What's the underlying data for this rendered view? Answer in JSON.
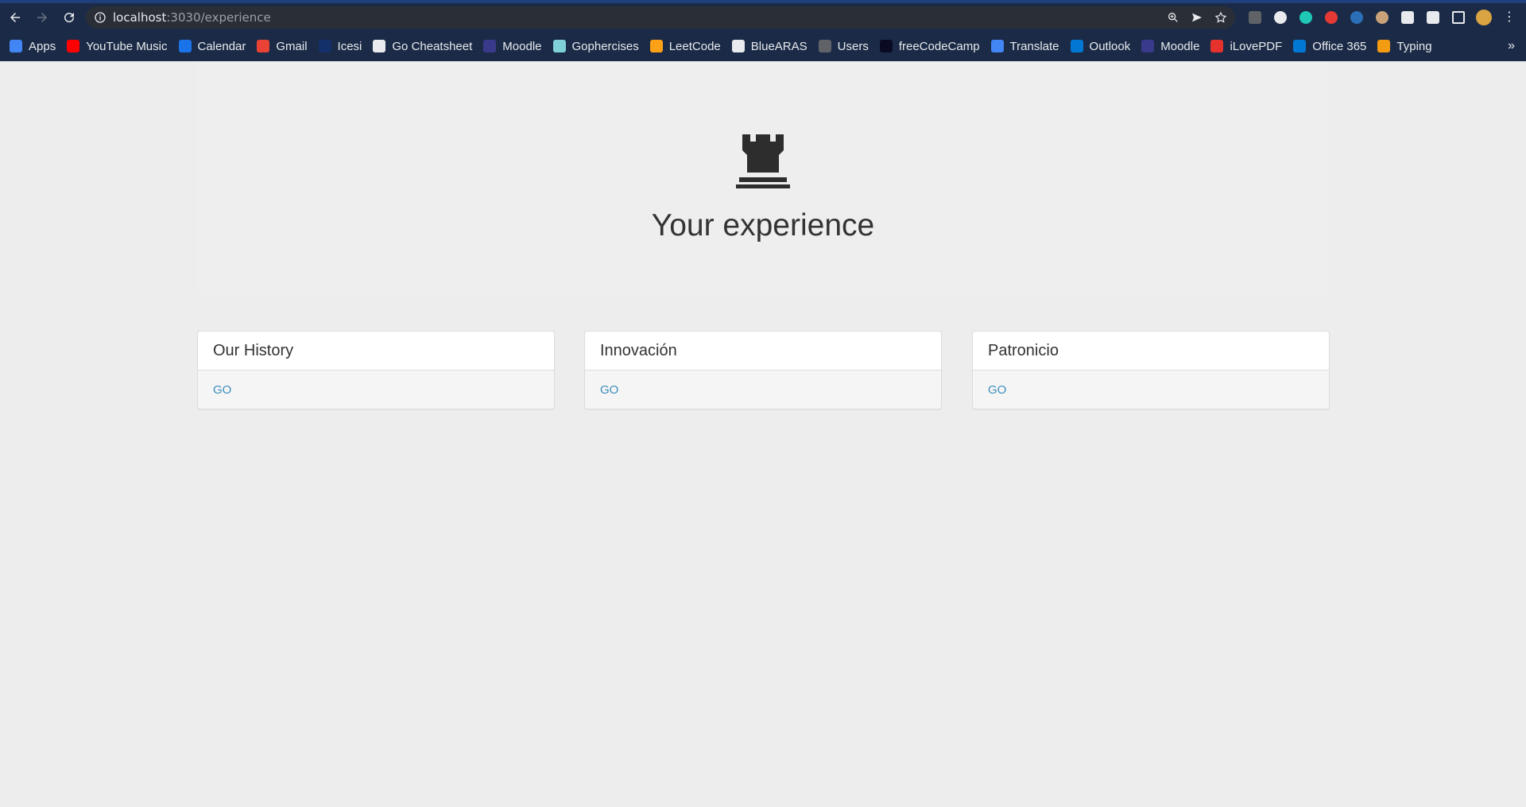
{
  "browser": {
    "url_host": "localhost",
    "url_path": ":3030/experience",
    "bookmarks": [
      {
        "label": "Apps",
        "icon": "apps-grid-icon",
        "color": "#4285f4"
      },
      {
        "label": "YouTube Music",
        "icon": "youtube-music-icon",
        "color": "#ff0000"
      },
      {
        "label": "Calendar",
        "icon": "calendar-icon",
        "color": "#1a73e8"
      },
      {
        "label": "Gmail",
        "icon": "gmail-icon",
        "color": "#ea4335"
      },
      {
        "label": "Icesi",
        "icon": "icesi-icon",
        "color": "#14306b"
      },
      {
        "label": "Go Cheatsheet",
        "icon": "github-icon",
        "color": "#e8eaed"
      },
      {
        "label": "Moodle",
        "icon": "moodle-icon",
        "color": "#3a3a8c"
      },
      {
        "label": "Gophercises",
        "icon": "gophercises-icon",
        "color": "#7fd0d8"
      },
      {
        "label": "LeetCode",
        "icon": "leetcode-icon",
        "color": "#ffa116"
      },
      {
        "label": "BlueARAS",
        "icon": "bluearas-icon",
        "color": "#e8eaed"
      },
      {
        "label": "Users",
        "icon": "globe-icon",
        "color": "#5f6368"
      },
      {
        "label": "freeCodeCamp",
        "icon": "freecodecamp-icon",
        "color": "#0a0a23"
      },
      {
        "label": "Translate",
        "icon": "translate-icon",
        "color": "#4285f4"
      },
      {
        "label": "Outlook",
        "icon": "outlook-icon",
        "color": "#0078d4"
      },
      {
        "label": "Moodle",
        "icon": "moodle-icon",
        "color": "#3a3a8c"
      },
      {
        "label": "iLovePDF",
        "icon": "ilovepdf-icon",
        "color": "#e5322d"
      },
      {
        "label": "Office 365",
        "icon": "office-icon",
        "color": "#0078d4"
      },
      {
        "label": "Typing",
        "icon": "typing-icon",
        "color": "#f39c12"
      }
    ],
    "more_label": "»"
  },
  "hero": {
    "icon": "chess-rook-icon",
    "title": "Your experience"
  },
  "cards": [
    {
      "title": "Our History",
      "link": "GO"
    },
    {
      "title": "Innovación",
      "link": "GO"
    },
    {
      "title": "Patronicio",
      "link": "GO"
    }
  ],
  "colors": {
    "chrome": "#1b2b47",
    "page_bg": "#ededed",
    "link": "#3c8dbc",
    "text": "#333333"
  }
}
